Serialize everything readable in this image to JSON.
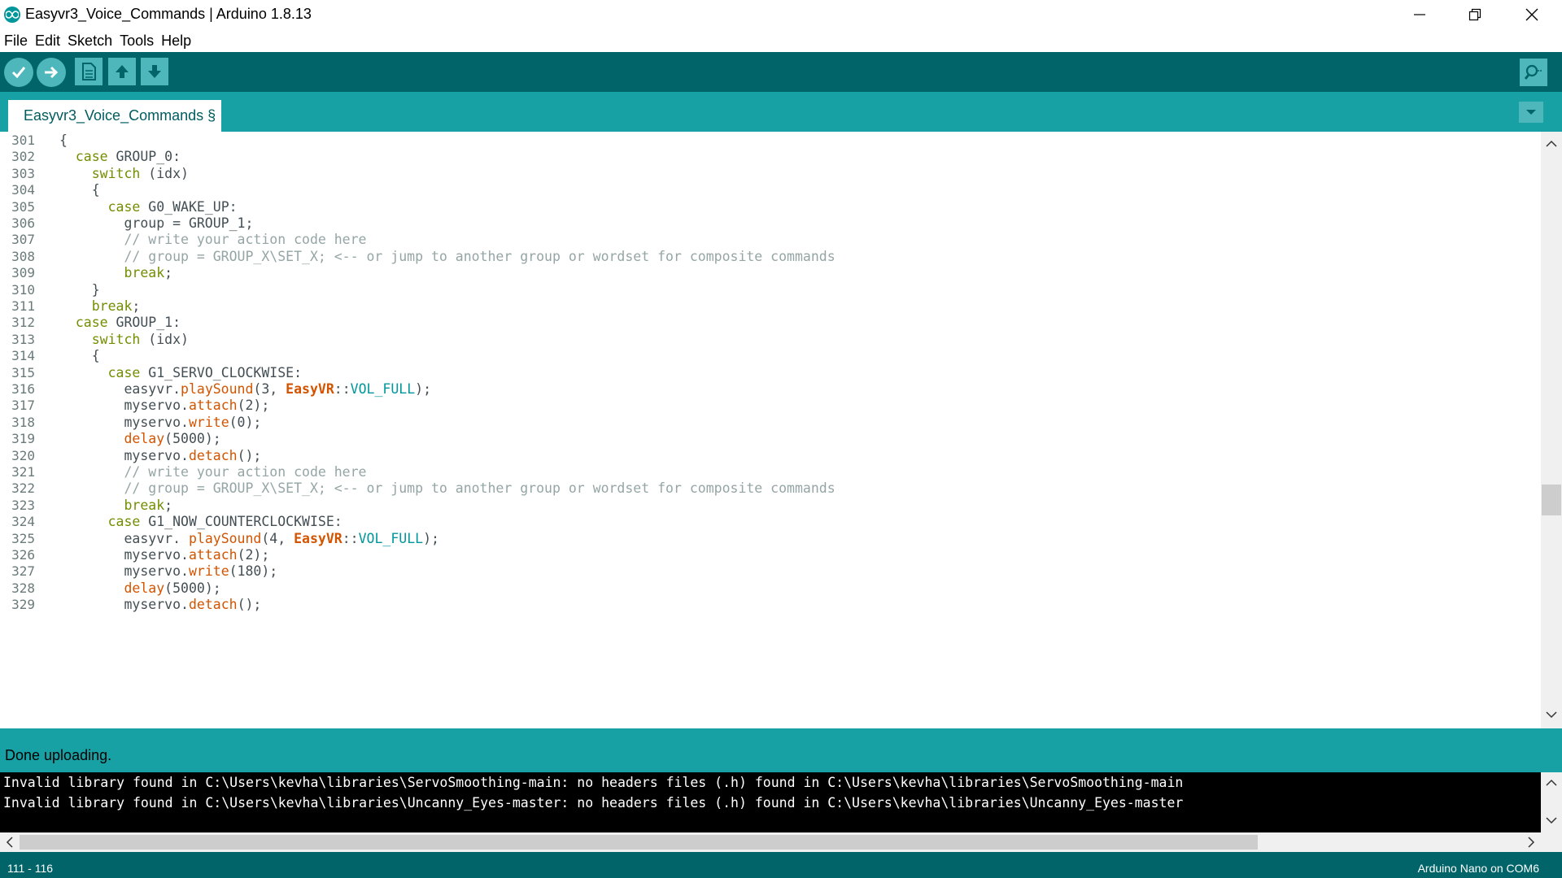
{
  "window": {
    "title": "Easyvr3_Voice_Commands | Arduino 1.8.13"
  },
  "menu": {
    "items": [
      "File",
      "Edit",
      "Sketch",
      "Tools",
      "Help"
    ]
  },
  "toolbar": {
    "buttons": [
      {
        "name": "verify",
        "icon": "check-icon"
      },
      {
        "name": "upload",
        "icon": "arrow-right-icon"
      },
      {
        "name": "new",
        "icon": "new-file-icon"
      },
      {
        "name": "open",
        "icon": "arrow-up-icon"
      },
      {
        "name": "save",
        "icon": "arrow-down-icon"
      }
    ],
    "serial_monitor_icon": "magnifier-icon"
  },
  "tabs": {
    "active_label": "Easyvr3_Voice_Commands §"
  },
  "editor": {
    "first_line_number": 301,
    "lines": [
      [
        {
          "t": "{",
          "c": ""
        }
      ],
      [
        {
          "t": "  ",
          "c": ""
        },
        {
          "t": "case",
          "c": "kw"
        },
        {
          "t": " GROUP_0:",
          "c": ""
        }
      ],
      [
        {
          "t": "    ",
          "c": ""
        },
        {
          "t": "switch",
          "c": "kw"
        },
        {
          "t": " (idx)",
          "c": ""
        }
      ],
      [
        {
          "t": "    {",
          "c": ""
        }
      ],
      [
        {
          "t": "      ",
          "c": ""
        },
        {
          "t": "case",
          "c": "kw"
        },
        {
          "t": " G0_WAKE_UP:",
          "c": ""
        }
      ],
      [
        {
          "t": "        group = GROUP_1;",
          "c": ""
        }
      ],
      [
        {
          "t": "        // write your action code here",
          "c": "cm"
        }
      ],
      [
        {
          "t": "        // group = GROUP_X\\SET_X; <-- or jump to another group or wordset for composite commands",
          "c": "cm"
        }
      ],
      [
        {
          "t": "        ",
          "c": ""
        },
        {
          "t": "break",
          "c": "kw"
        },
        {
          "t": ";",
          "c": ""
        }
      ],
      [
        {
          "t": "    }",
          "c": ""
        }
      ],
      [
        {
          "t": "    ",
          "c": ""
        },
        {
          "t": "break",
          "c": "kw"
        },
        {
          "t": ";",
          "c": ""
        }
      ],
      [
        {
          "t": "  ",
          "c": ""
        },
        {
          "t": "case",
          "c": "kw"
        },
        {
          "t": " GROUP_1:",
          "c": ""
        }
      ],
      [
        {
          "t": "    ",
          "c": ""
        },
        {
          "t": "switch",
          "c": "kw"
        },
        {
          "t": " (idx)",
          "c": ""
        }
      ],
      [
        {
          "t": "    {",
          "c": ""
        }
      ],
      [
        {
          "t": "      ",
          "c": ""
        },
        {
          "t": "case",
          "c": "kw"
        },
        {
          "t": " G1_SERVO_CLOCKWISE:",
          "c": ""
        }
      ],
      [
        {
          "t": "        easyvr.",
          "c": ""
        },
        {
          "t": "playSound",
          "c": "fn"
        },
        {
          "t": "(3, ",
          "c": ""
        },
        {
          "t": "EasyVR",
          "c": "cls"
        },
        {
          "t": "::",
          "c": ""
        },
        {
          "t": "VOL_FULL",
          "c": "cst"
        },
        {
          "t": ");",
          "c": ""
        }
      ],
      [
        {
          "t": "        myservo.",
          "c": ""
        },
        {
          "t": "attach",
          "c": "fn"
        },
        {
          "t": "(2);",
          "c": ""
        }
      ],
      [
        {
          "t": "        myservo.",
          "c": ""
        },
        {
          "t": "write",
          "c": "fn"
        },
        {
          "t": "(0);",
          "c": ""
        }
      ],
      [
        {
          "t": "        ",
          "c": ""
        },
        {
          "t": "delay",
          "c": "fn"
        },
        {
          "t": "(5000);",
          "c": ""
        }
      ],
      [
        {
          "t": "        myservo.",
          "c": ""
        },
        {
          "t": "detach",
          "c": "fn"
        },
        {
          "t": "();",
          "c": ""
        }
      ],
      [
        {
          "t": "        // write your action code here",
          "c": "cm"
        }
      ],
      [
        {
          "t": "        // group = GROUP_X\\SET_X; <-- or jump to another group or wordset for composite commands",
          "c": "cm"
        }
      ],
      [
        {
          "t": "        ",
          "c": ""
        },
        {
          "t": "break",
          "c": "kw"
        },
        {
          "t": ";",
          "c": ""
        }
      ],
      [
        {
          "t": "      ",
          "c": ""
        },
        {
          "t": "case",
          "c": "kw"
        },
        {
          "t": " G1_NOW_COUNTERCLOCKWISE:",
          "c": ""
        }
      ],
      [
        {
          "t": "        easyvr. ",
          "c": ""
        },
        {
          "t": "playSound",
          "c": "fn"
        },
        {
          "t": "(4, ",
          "c": ""
        },
        {
          "t": "EasyVR",
          "c": "cls"
        },
        {
          "t": "::",
          "c": ""
        },
        {
          "t": "VOL_FULL",
          "c": "cst"
        },
        {
          "t": ");",
          "c": ""
        }
      ],
      [
        {
          "t": "        myservo.",
          "c": ""
        },
        {
          "t": "attach",
          "c": "fn"
        },
        {
          "t": "(2);",
          "c": ""
        }
      ],
      [
        {
          "t": "        myservo.",
          "c": ""
        },
        {
          "t": "write",
          "c": "fn"
        },
        {
          "t": "(180);",
          "c": ""
        }
      ],
      [
        {
          "t": "        ",
          "c": ""
        },
        {
          "t": "delay",
          "c": "fn"
        },
        {
          "t": "(5000);",
          "c": ""
        }
      ],
      [
        {
          "t": "        myservo.",
          "c": ""
        },
        {
          "t": "detach",
          "c": "fn"
        },
        {
          "t": "();",
          "c": ""
        }
      ]
    ]
  },
  "status": {
    "message": "Done uploading."
  },
  "console": {
    "lines": [
      "Invalid library found in C:\\Users\\kevha\\libraries\\ServoSmoothing-main: no headers files (.h) found in C:\\Users\\kevha\\libraries\\ServoSmoothing-main",
      "Invalid library found in C:\\Users\\kevha\\libraries\\Uncanny_Eyes-master: no headers files (.h) found in C:\\Users\\kevha\\libraries\\Uncanny_Eyes-master"
    ]
  },
  "footer": {
    "line_range": "111 - 116",
    "board": "Arduino Nano on COM6"
  },
  "colors": {
    "toolbar": "#006468",
    "tabbar": "#17a1a5",
    "button": "#4db7bb",
    "keyword": "#728e00",
    "function": "#d35400",
    "comment": "#95a5a6",
    "constant": "#00979c"
  }
}
